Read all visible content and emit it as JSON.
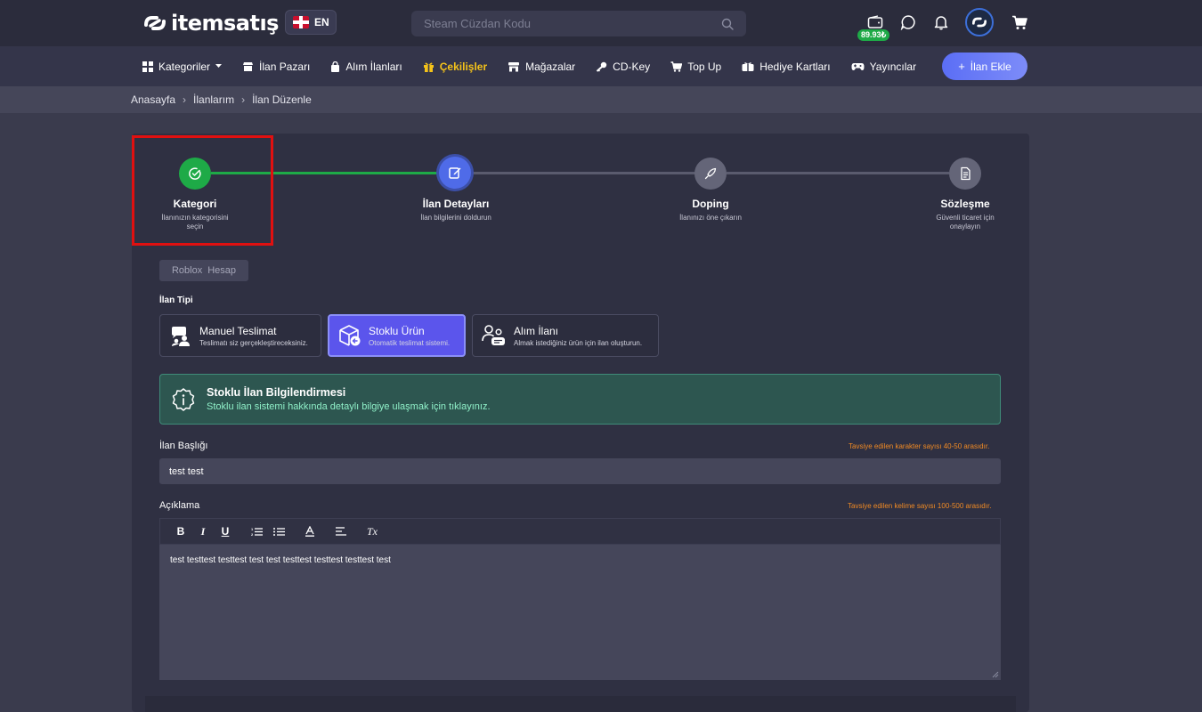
{
  "header": {
    "logo_text": "itemsatış",
    "lang_label": "EN",
    "search_placeholder": "Steam Cüzdan Kodu",
    "wallet_balance": "89.93₺"
  },
  "nav": {
    "items": [
      {
        "label": "Kategoriler",
        "icon": "grid-icon"
      },
      {
        "label": "İlan Pazarı",
        "icon": "shop-icon"
      },
      {
        "label": "Alım İlanları",
        "icon": "bag-icon"
      },
      {
        "label": "Çekilişler",
        "icon": "gift-icon"
      },
      {
        "label": "Mağazalar",
        "icon": "store-icon"
      },
      {
        "label": "CD-Key",
        "icon": "key-icon"
      },
      {
        "label": "Top Up",
        "icon": "cart-icon"
      },
      {
        "label": "Hediye Kartları",
        "icon": "giftcard-icon"
      },
      {
        "label": "Yayıncılar",
        "icon": "gamepad-icon"
      }
    ],
    "add_button": "İlan Ekle"
  },
  "breadcrumb": [
    "Anasayfa",
    "İlanlarım",
    "İlan Düzenle"
  ],
  "steps": [
    {
      "title": "Kategori",
      "subtitle": "İlanınızın kategorisini seçin",
      "state": "done",
      "icon": "check-circle-icon"
    },
    {
      "title": "İlan Detayları",
      "subtitle": "İlan bilgilerini doldurun",
      "state": "active",
      "icon": "edit-icon"
    },
    {
      "title": "Doping",
      "subtitle": "İlanınızı öne çıkarın",
      "state": "pending",
      "icon": "rocket-icon"
    },
    {
      "title": "Sözleşme",
      "subtitle": "Güvenli ticaret için onaylayın",
      "state": "pending",
      "icon": "document-icon"
    }
  ],
  "category_path": [
    "Roblox",
    "Hesap"
  ],
  "listing_type": {
    "label": "İlan Tipi",
    "options": [
      {
        "title": "Manuel Teslimat",
        "desc": "Teslimatı siz gerçekleştireceksiniz.",
        "icon": "chat-users-icon",
        "active": false
      },
      {
        "title": "Stoklu Ürün",
        "desc": "Otomatik teslimat sistemi.",
        "icon": "box-icon",
        "active": true
      },
      {
        "title": "Alım İlanı",
        "desc": "Almak istediğiniz ürün için ilan oluşturun.",
        "icon": "user-chat-icon",
        "active": false
      }
    ]
  },
  "info": {
    "title": "Stoklu İlan Bilgilendirmesi",
    "desc": "Stoklu ilan sistemi hakkında detaylı bilgiye ulaşmak için tıklayınız."
  },
  "title_field": {
    "label": "İlan Başlığı",
    "hint": "Tavsiye edilen karakter sayısı 40-50 arasıdır.",
    "value": "test test"
  },
  "description_field": {
    "label": "Açıklama",
    "hint": "Tavsiye edilen kelime sayısı 100-500 arasıdır.",
    "value": "test testtest testtest test test testtest testtest testtest test",
    "toolbar": {
      "bold": "B",
      "italic": "I",
      "underline": "U",
      "clear": "Tx"
    }
  },
  "colors": {
    "accent": "#5b55ec",
    "success": "#1eaa47",
    "highlight": "#f4c21a",
    "hint": "#f08a24"
  }
}
